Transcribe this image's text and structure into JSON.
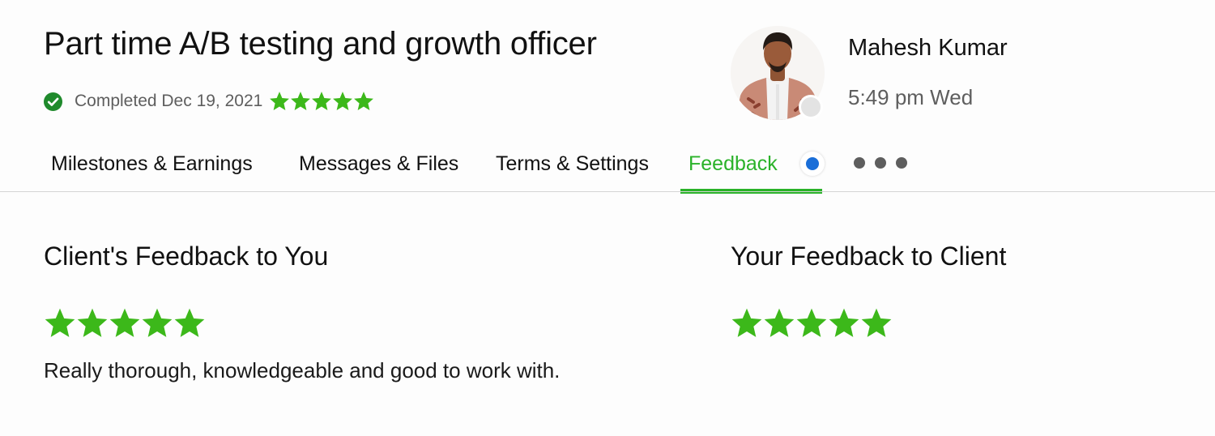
{
  "job": {
    "title": "Part time A/B testing and growth officer",
    "status": "Completed Dec 19, 2021",
    "rating": 5
  },
  "client": {
    "name": "Mahesh Kumar",
    "local_time": "5:49 pm Wed"
  },
  "tabs": [
    {
      "label": "Milestones & Earnings",
      "active": false
    },
    {
      "label": "Messages & Files",
      "active": false
    },
    {
      "label": "Terms & Settings",
      "active": false
    },
    {
      "label": "Feedback",
      "active": true
    }
  ],
  "feedback": {
    "client_to_you": {
      "title": "Client's Feedback to You",
      "rating": 5,
      "comment": "Really thorough, knowledgeable and good to work with."
    },
    "you_to_client": {
      "title": "Your Feedback to Client",
      "rating": 5
    }
  },
  "colors": {
    "accent_green": "#2ab229",
    "star_green": "#3cb81a",
    "notification_blue": "#1a6ed8",
    "muted_text": "#5e5e5e"
  },
  "icons": {
    "status": "check-circle-icon",
    "rating": "star-icon",
    "more": "more-horizontal-icon",
    "presence": "presence-dot-icon"
  }
}
